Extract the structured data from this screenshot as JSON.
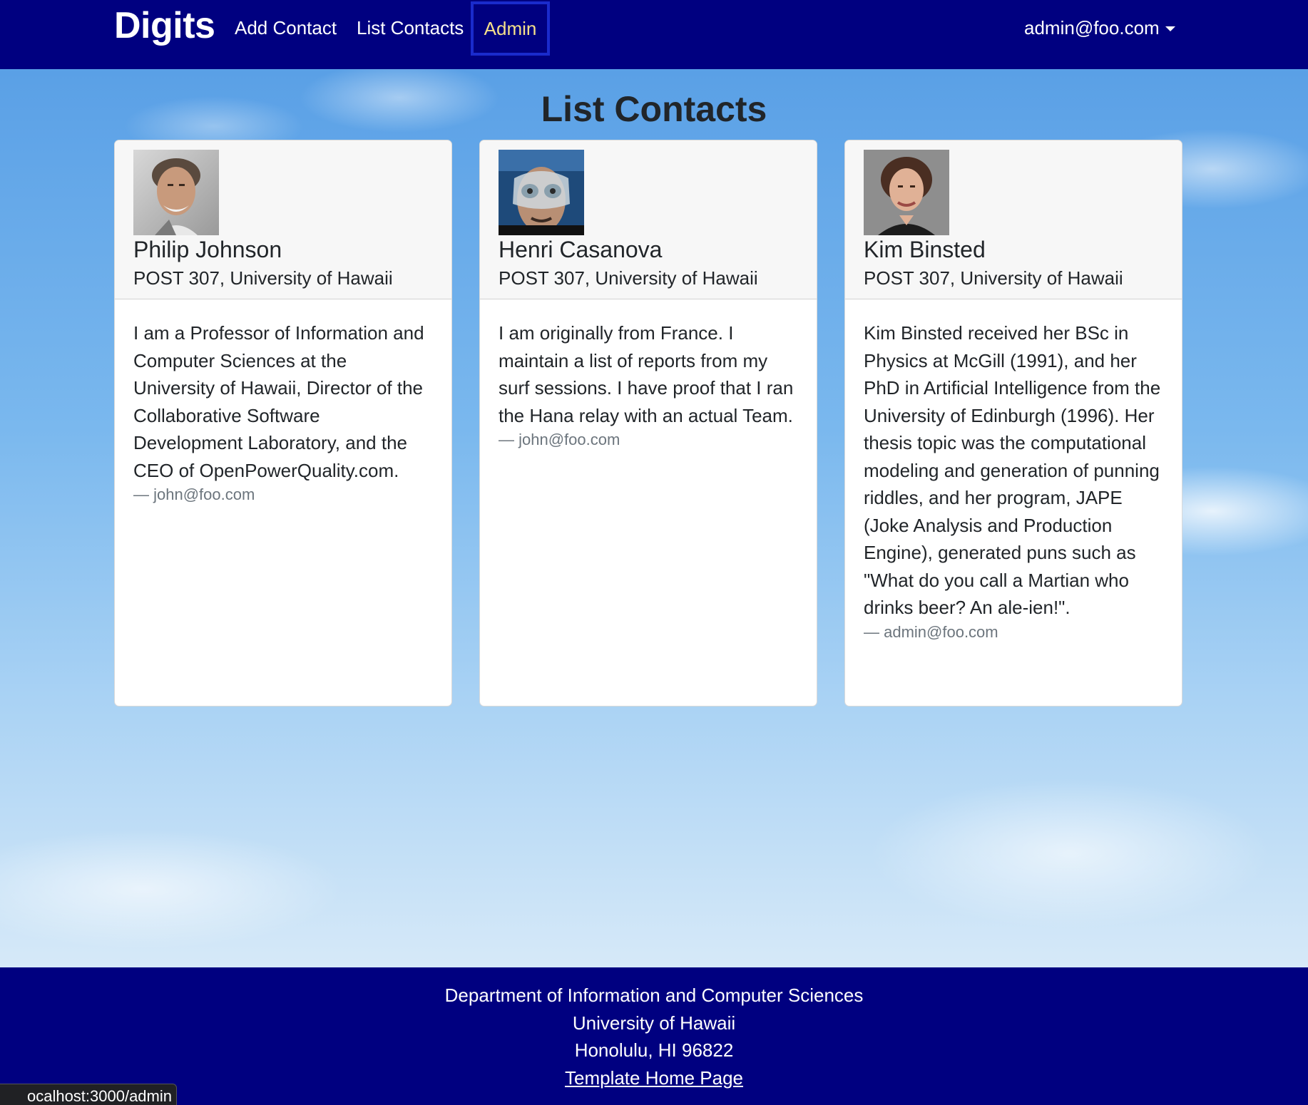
{
  "navbar": {
    "brand": "Digits",
    "links": [
      {
        "label": "Add Contact"
      },
      {
        "label": "List Contacts"
      },
      {
        "label": "Admin"
      }
    ],
    "user": "admin@foo.com"
  },
  "page": {
    "title": "List Contacts"
  },
  "contacts": [
    {
      "name": "Philip Johnson",
      "address": "POST 307, University of Hawaii",
      "description": "I am a Professor of Information and Computer Sciences at the University of Hawaii, Director of the Collaborative Software Development Laboratory, and the CEO of OpenPowerQuality.com.",
      "owner": "— john@foo.com"
    },
    {
      "name": "Henri Casanova",
      "address": "POST 307, University of Hawaii",
      "description": "I am originally from France. I maintain a list of reports from my surf sessions. I have proof that I ran the Hana relay with an actual Team.",
      "owner": "— john@foo.com"
    },
    {
      "name": "Kim Binsted",
      "address": "POST 307, University of Hawaii",
      "description": "Kim Binsted received her BSc in Physics at McGill (1991), and her PhD in Artificial Intelligence from the University of Edinburgh (1996). Her thesis topic was the computational modeling and generation of punning riddles, and her program, JAPE (Joke Analysis and Production Engine), generated puns such as \"What do you call a Martian who drinks beer? An ale-ien!\".",
      "owner": "— admin@foo.com"
    }
  ],
  "footer": {
    "line1": "Department of Information and Computer Sciences",
    "line2": "University of Hawaii",
    "line3": "Honolulu, HI 96822",
    "link": "Template Home Page"
  },
  "status_bar": {
    "url": "ocalhost:3000/admin"
  }
}
